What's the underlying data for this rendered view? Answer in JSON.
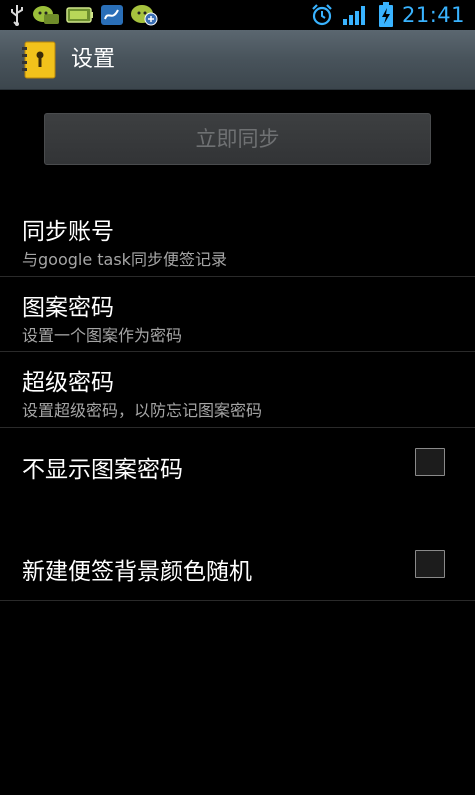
{
  "status_bar": {
    "left_icons": [
      "usb-icon",
      "chat-icon",
      "battery-app-icon",
      "sync-app-icon",
      "chat-update-icon"
    ],
    "right_icons": [
      "alarm-icon",
      "signal-icon",
      "battery-charging-icon"
    ],
    "time": "21:41",
    "accent_color": "#39b3ff"
  },
  "title_bar": {
    "title": "设置",
    "icon": "notepad-lock-icon"
  },
  "sync_button": {
    "label": "立即同步"
  },
  "settings": [
    {
      "title": "同步账号",
      "subtitle": "与google task同步便签记录"
    },
    {
      "title": "图案密码",
      "subtitle": "设置一个图案作为密码"
    },
    {
      "title": "超级密码",
      "subtitle": "设置超级密码，以防忘记图案密码"
    },
    {
      "title": "不显示图案密码",
      "checked": false
    },
    {
      "title": "新建便签背景颜色随机",
      "checked": false
    }
  ]
}
